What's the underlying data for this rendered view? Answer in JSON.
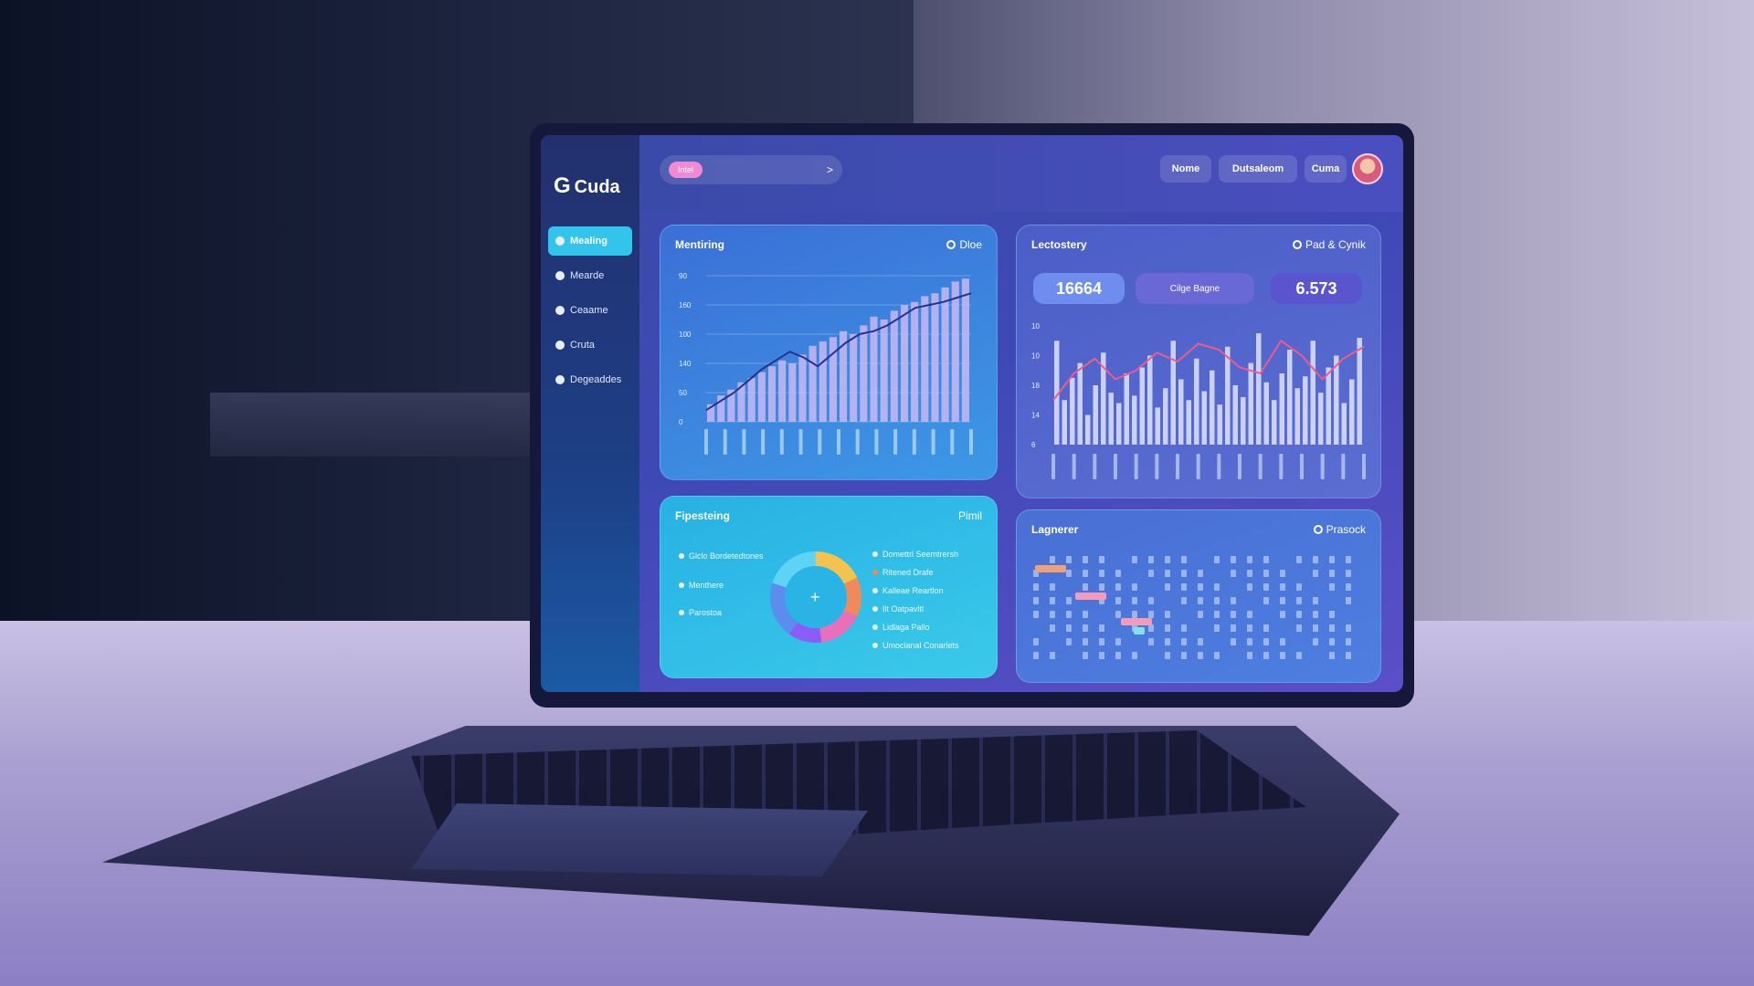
{
  "app": {
    "brand": "Cuda",
    "accent": "#33c4ec",
    "colors": {
      "sidebar": "#23306e",
      "screen": "#3f49b6",
      "card_cyan": "#2fc0ea",
      "pink": "#f08ad5"
    }
  },
  "sidebar": {
    "items": [
      {
        "label": "Mealing",
        "icon": "dashboard-icon",
        "active": true
      },
      {
        "label": "Mearde",
        "icon": "chat-icon",
        "active": false
      },
      {
        "label": "Ceaame",
        "icon": "user-icon",
        "active": false
      },
      {
        "label": "Cruta",
        "icon": "settings-icon",
        "active": false
      },
      {
        "label": "Degeaddes",
        "icon": "info-icon",
        "active": false
      }
    ]
  },
  "topbar": {
    "search_tag": "Intel",
    "chevron": ">",
    "nav": [
      "Nome",
      "Dutsaleom",
      "Cuma"
    ]
  },
  "cards": {
    "trend": {
      "title": "Mentiring",
      "action": "Dloe"
    },
    "lectory": {
      "title": "Lectostery",
      "action": "Pad & Cynik",
      "stat1": "16664",
      "filter": "Cilge Bagne",
      "stat2": "6.573"
    },
    "donut": {
      "title": "Fipesteing",
      "action": "Pimil",
      "left_legend": [
        "Glclo Bordetedtones",
        "Menthere",
        "Parostoa"
      ],
      "right_legend": [
        "Domettrl Seemtrersh",
        "Ritened Drafe",
        "Kalleae Reartlon",
        "Ilt Oatpavltl",
        "Lidlaga Pallo",
        "Umoclanal Conarlets"
      ]
    },
    "matrix": {
      "title": "Lagnerer",
      "action": "Prasock"
    }
  },
  "chart_data": [
    {
      "type": "bar",
      "title": "Mentiring",
      "y_ticks": [
        "90",
        "160",
        "100",
        "140",
        "50",
        "0"
      ],
      "values": [
        12,
        18,
        22,
        27,
        30,
        34,
        38,
        42,
        40,
        46,
        52,
        55,
        58,
        62,
        60,
        66,
        72,
        70,
        76,
        80,
        82,
        86,
        88,
        92,
        96,
        98
      ],
      "line": [
        8,
        14,
        20,
        28,
        36,
        42,
        48,
        44,
        38,
        46,
        54,
        60,
        62,
        66,
        72,
        78,
        80,
        82,
        85,
        88
      ]
    },
    {
      "type": "bar",
      "title": "Lectostery",
      "y_ticks": [
        "10",
        "10",
        "18",
        "14",
        "6"
      ],
      "values": [
        70,
        30,
        45,
        55,
        20,
        40,
        62,
        35,
        28,
        48,
        33,
        52,
        60,
        25,
        38,
        70,
        44,
        30,
        58,
        36,
        50,
        27,
        66,
        40,
        32,
        55,
        75,
        42,
        30,
        48,
        64,
        38,
        46,
        70,
        35,
        52,
        60,
        28,
        44,
        72
      ],
      "line": [
        30,
        48,
        58,
        44,
        50,
        62,
        56,
        68,
        64,
        52,
        48,
        70,
        60,
        44,
        58,
        66
      ]
    },
    {
      "type": "pie",
      "title": "Fipesteing",
      "values": [
        18,
        14,
        16,
        12,
        20,
        20
      ],
      "colors": [
        "#f4c24e",
        "#f08a5d",
        "#e86fb9",
        "#8b5cf6",
        "#5b8def",
        "#5fd3f3"
      ]
    }
  ]
}
